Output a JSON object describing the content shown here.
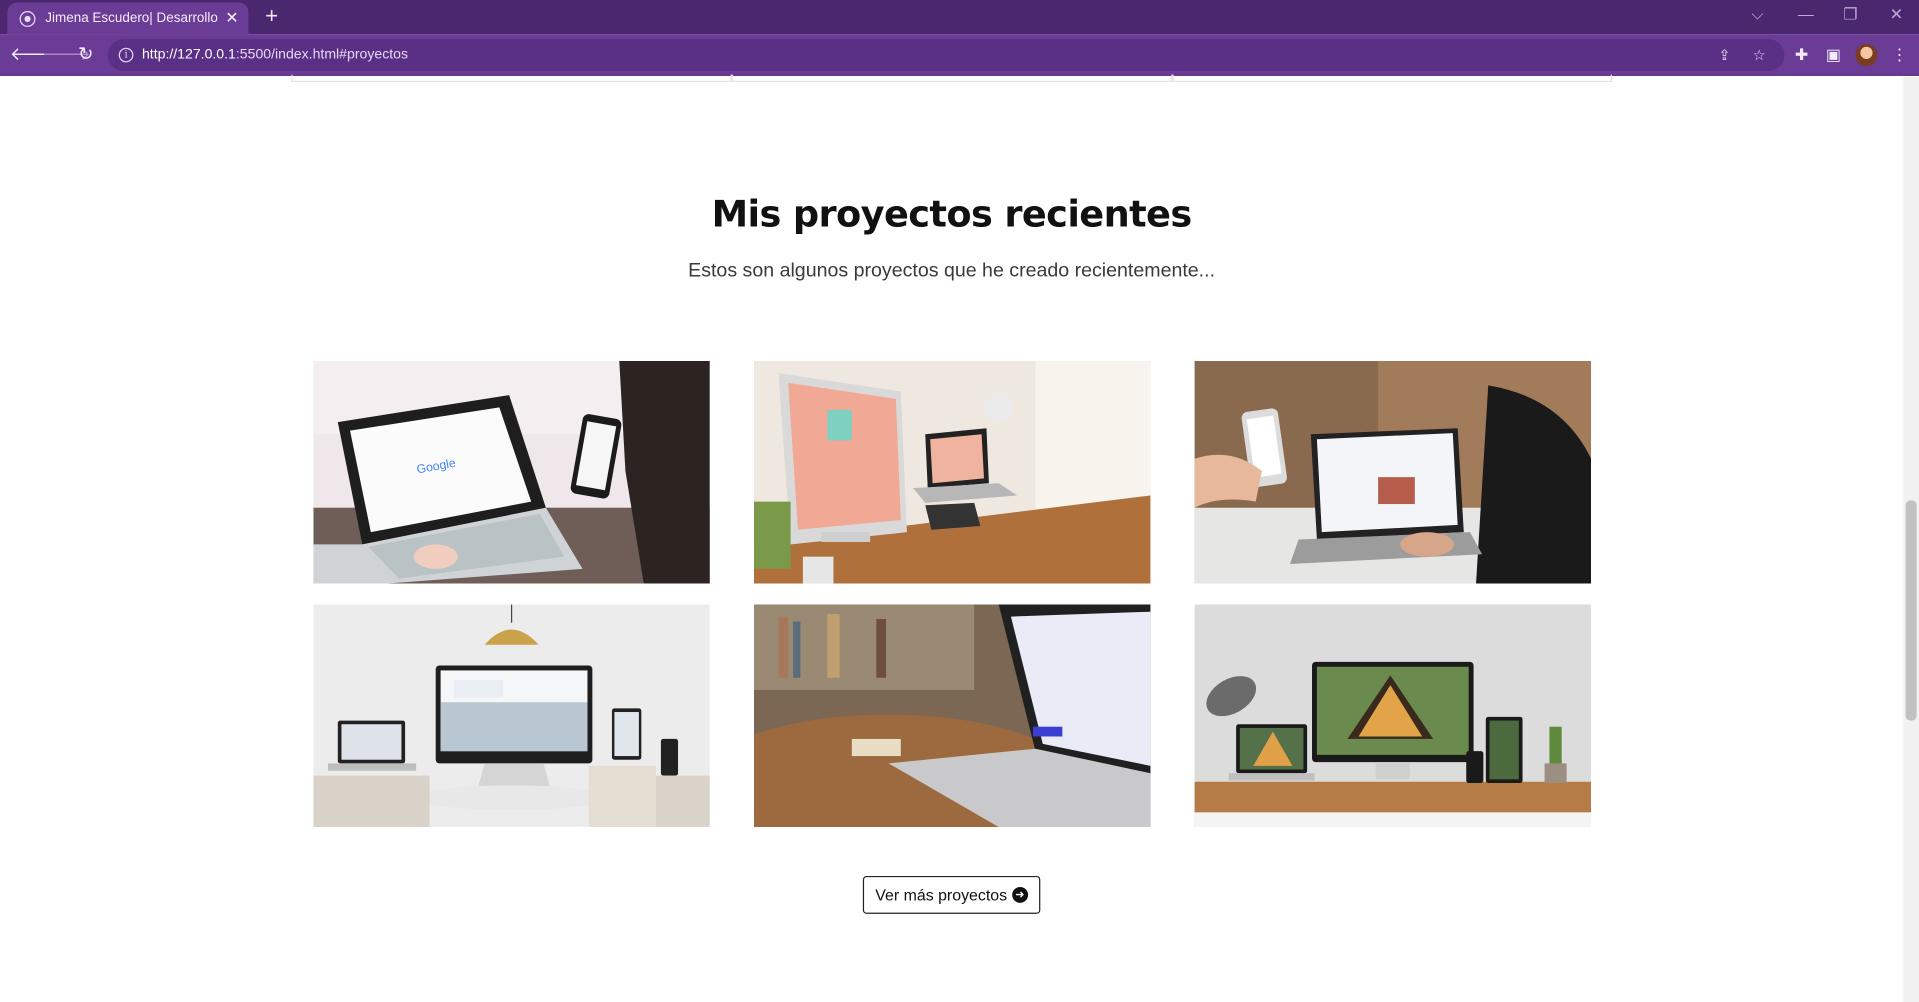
{
  "browser": {
    "tab_title": "Jimena Escudero| Desarrollo Web",
    "tab_close": "✕",
    "new_tab": "+",
    "url_host": "http://127.0.0.1",
    "url_rest": ":5500/index.html#proyectos",
    "accent_color": "#6a3c96",
    "tabbar_color": "#4b2770"
  },
  "projects": {
    "title": "Mis proyectos recientes",
    "subtitle": "Estos son algunos proyectos que he creado recientemente...",
    "cards": [
      {
        "icon": "laptop-google-photo"
      },
      {
        "icon": "imac-creativity-desk-photo"
      },
      {
        "icon": "phone-laptop-hands-photo"
      },
      {
        "icon": "responsive-web-design-photo"
      },
      {
        "icon": "laptop-bookshelf-photo"
      },
      {
        "icon": "architect-studio-devices-photo"
      }
    ],
    "more_button": "Ver más proyectos",
    "more_button_icon": "arrow-right-circle-icon"
  }
}
